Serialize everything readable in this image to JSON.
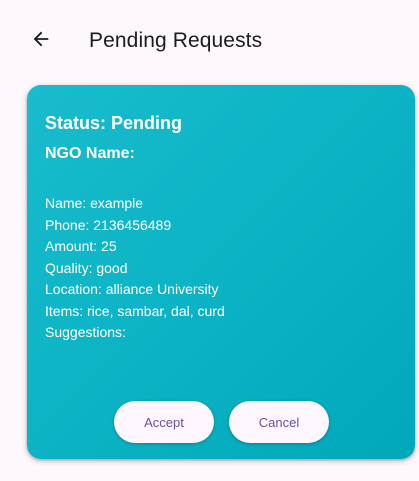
{
  "app_bar": {
    "title": "Pending Requests",
    "back_icon": "arrow-left-icon"
  },
  "request": {
    "status": "Status: Pending",
    "ngo_name": "NGO Name:",
    "details": [
      "Name: example",
      "Phone: 2136456489",
      "Amount: 25",
      "Quality: good",
      "Location: alliance University",
      "Items: rice, sambar, dal, curd",
      "Suggestions:"
    ],
    "accept_label": "Accept",
    "cancel_label": "Cancel"
  },
  "colors": {
    "background": "#fdf8fc",
    "card": "#0bb3c4",
    "button_bg": "#fef7ff",
    "button_text": "#6750a4",
    "title_text": "#1d1b20"
  }
}
